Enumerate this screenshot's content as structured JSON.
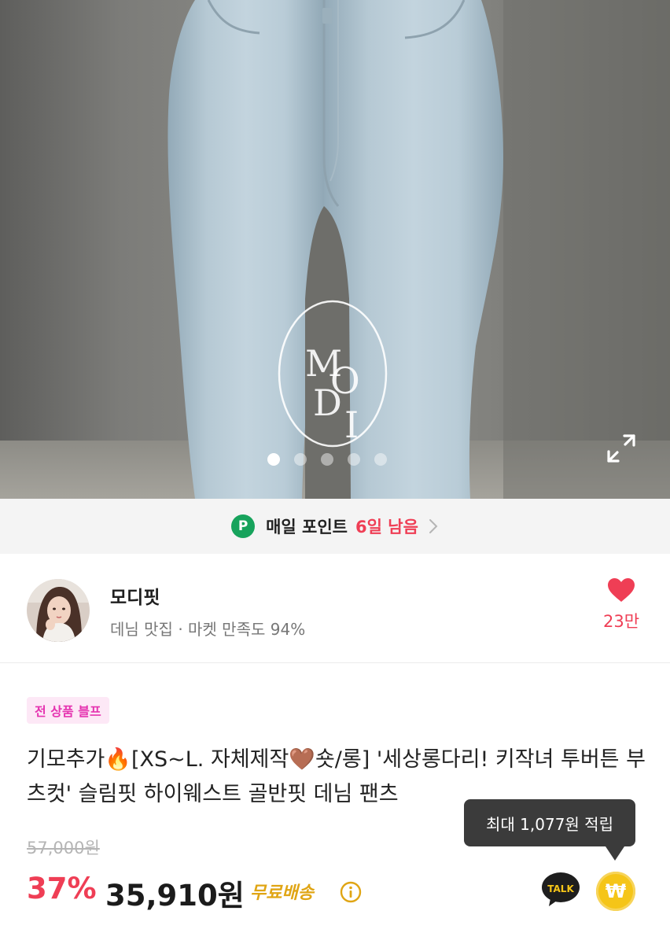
{
  "hero": {
    "logo_text": "MODI",
    "dot_count": 5,
    "active_dot": 0,
    "expand_icon": "expand-arrows-icon"
  },
  "daily_point": {
    "badge": "P",
    "label": "매일 포인트",
    "days_left": "6일 남음",
    "chevron_icon": "chevron-right-icon"
  },
  "store": {
    "name": "모디핏",
    "subtitle": "데님 맛집 · 마켓 만족도 94%",
    "likes": "23만",
    "heart_color": "#ef3e55"
  },
  "product": {
    "promo_badge": "전 상품 블프",
    "title": "기모추가🔥[XS~L. 자체제작🤎숏/롱] '세상롱다리! 키작녀 투버튼 부츠컷' 슬림핏 하이웨스트 골반핏 데님 팬츠",
    "original_price": "57,000원",
    "discount": "37%",
    "price": "35,910원",
    "shipping": "무료배송",
    "tooltip": "최대 1,077원 적립",
    "talk_label": "TALK",
    "won_symbol": "₩"
  },
  "colors": {
    "accent_red": "#ef3e55",
    "point_green": "#17a35c",
    "shipping_gold": "#e0a514",
    "promo_pink": "#e534b0"
  }
}
